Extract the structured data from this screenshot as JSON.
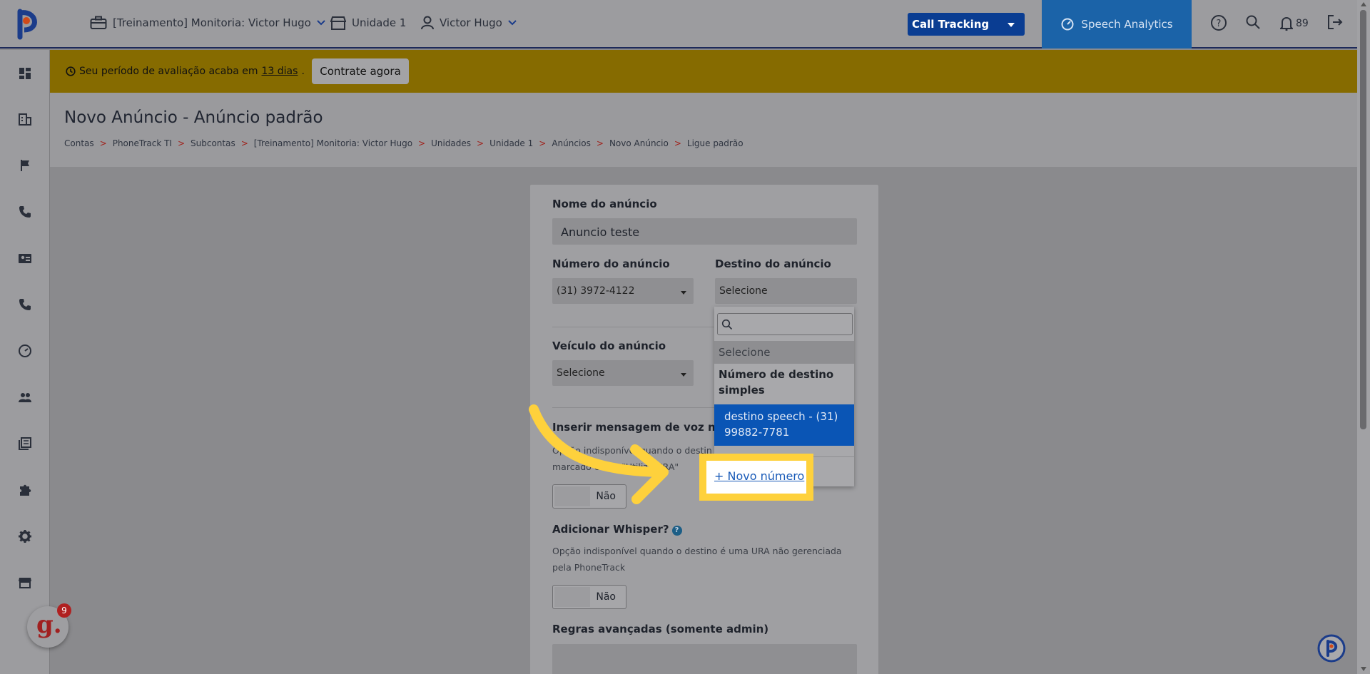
{
  "topbar": {
    "account": "[Treinamento] Monitoria: Victor Hugo",
    "unit": "Unidade 1",
    "user": "Victor Hugo",
    "product_select": "Call Tracking",
    "speech_analytics": "Speech Analytics",
    "notifications_count": "89"
  },
  "banner": {
    "text_before": "Seu período de avaliação acaba em",
    "days": "13 dias",
    "text_after": ".",
    "cta": "Contrate agora",
    "color": "#866b00"
  },
  "page": {
    "title": "Novo Anúncio - Anúncio padrão",
    "breadcrumb": [
      "Contas",
      "PhoneTrack TI",
      "Subcontas",
      "[Treinamento] Monitoria: Victor Hugo",
      "Unidades",
      "Unidade 1",
      "Anúncios",
      "Novo Anúncio",
      "Ligue padrão"
    ],
    "breadcrumb_sep": ">"
  },
  "form": {
    "name_label": "Nome do anúncio",
    "name_value": "Anuncio teste",
    "number_label": "Número do anúncio",
    "number_value": "(31) 3972-4122",
    "destination_label": "Destino do anúncio",
    "destination_value": "Selecione",
    "vehicle_label": "Veículo do anúncio",
    "vehicle_value": "Selecione",
    "voice_label": "Inserir mensagem de voz na ch",
    "voice_hint_1": "Opção indisponível quando o destin",
    "voice_hint_2": "marcado como \"Utiliza URA\"",
    "voice_toggle": "Não",
    "whisper_label": "Adicionar Whisper?",
    "whisper_hint_1": "Opção indisponível quando o destino é uma URA não gerenciada",
    "whisper_hint_2": "pela PhoneTrack",
    "whisper_toggle": "Não",
    "advanced_label": "Regras avançadas (somente admin)"
  },
  "dropdown": {
    "placeholder": "Selecione",
    "group": "Número de destino simples",
    "selected_option": "destino speech - (31) 99882-7781",
    "new_number_link": "+ Novo número",
    "selected_color": "#0a55b5"
  },
  "highlight": {
    "color": "#fed13c"
  },
  "widgets": {
    "g_count": "9",
    "g_letter": "g."
  },
  "sidebar_icons": [
    "dashboard-icon",
    "building-icon",
    "flag-icon",
    "phone-icon",
    "contact-card-icon",
    "phone-call-icon",
    "speedometer-icon",
    "users-icon",
    "book-icon",
    "puzzle-icon",
    "gear-icon",
    "store-icon"
  ]
}
